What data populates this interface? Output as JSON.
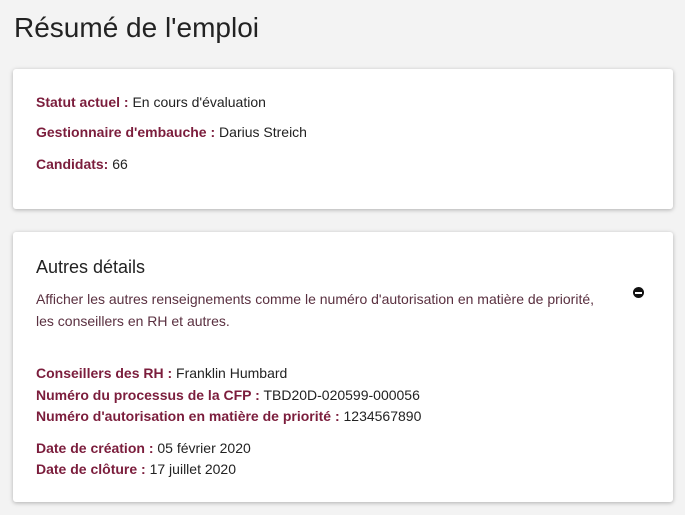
{
  "page": {
    "title": "Résumé de l'emploi"
  },
  "summary": {
    "status_label": "Statut actuel :",
    "status_value": "En cours d'évaluation",
    "manager_label": "Gestionnaire d'embauche :",
    "manager_value": "Darius Streich",
    "candidates_label": "Candidats:",
    "candidates_value": "66"
  },
  "details": {
    "title": "Autres détails",
    "description": "Afficher les autres renseignements comme le numéro d'autorisation en matière de priorité, les conseillers en RH et autres.",
    "toggle_icon": "minus-circle-icon",
    "hr_label": "Conseillers des RH :",
    "hr_value": "Franklin Humbard",
    "process_label": "Numéro du processus de la CFP :",
    "process_value": "TBD20D-020599-000056",
    "priority_label": "Numéro d'autorisation en matière de priorité :",
    "priority_value": "1234567890",
    "created_label": "Date de création :",
    "created_value": "05 février 2020",
    "closing_label": "Date de clôture :",
    "closing_value": "17 juillet 2020"
  }
}
